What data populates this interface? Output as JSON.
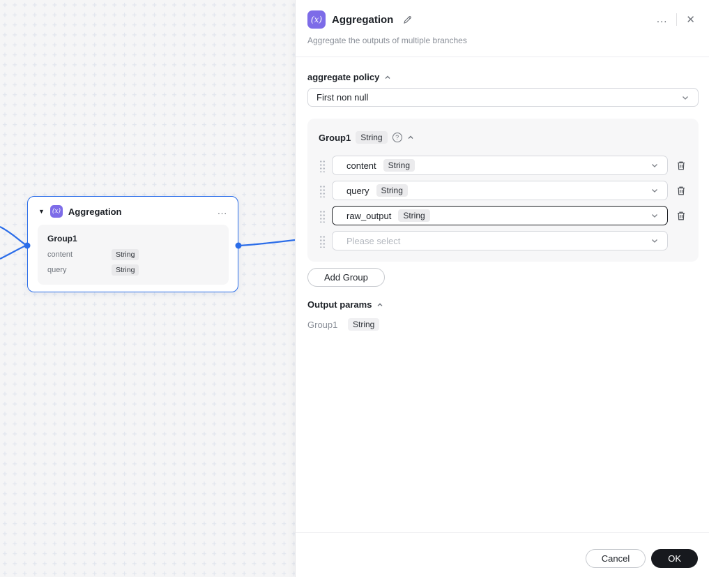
{
  "canvas": {
    "node": {
      "icon_text": "(x)",
      "title": "Aggregation",
      "more": "...",
      "group_name": "Group1",
      "params": [
        {
          "name": "content",
          "type": "String"
        },
        {
          "name": "query",
          "type": "String"
        }
      ]
    }
  },
  "panel": {
    "icon_text": "(x)",
    "title": "Aggregation",
    "subtitle": "Aggregate the outputs of multiple branches",
    "more": "...",
    "close": "✕",
    "aggregate_policy": {
      "label": "aggregate policy",
      "selected": "First non null"
    },
    "group": {
      "name": "Group1",
      "type": "String",
      "help": "?",
      "rows": [
        {
          "name": "content",
          "type": "String"
        },
        {
          "name": "query",
          "type": "String"
        },
        {
          "name": "raw_output",
          "type": "String"
        },
        {
          "placeholder": "Please select"
        }
      ]
    },
    "add_group_label": "Add Group",
    "output_params": {
      "label": "Output params",
      "items": [
        {
          "name": "Group1",
          "type": "String"
        }
      ]
    },
    "footer": {
      "cancel_label": "Cancel",
      "ok_label": "OK"
    }
  },
  "colors": {
    "accent_purple": "#7d6ce8",
    "selection_blue": "#2b6de9",
    "ok_button": "#17191e",
    "canvas_bg": "#f5f5f6"
  }
}
